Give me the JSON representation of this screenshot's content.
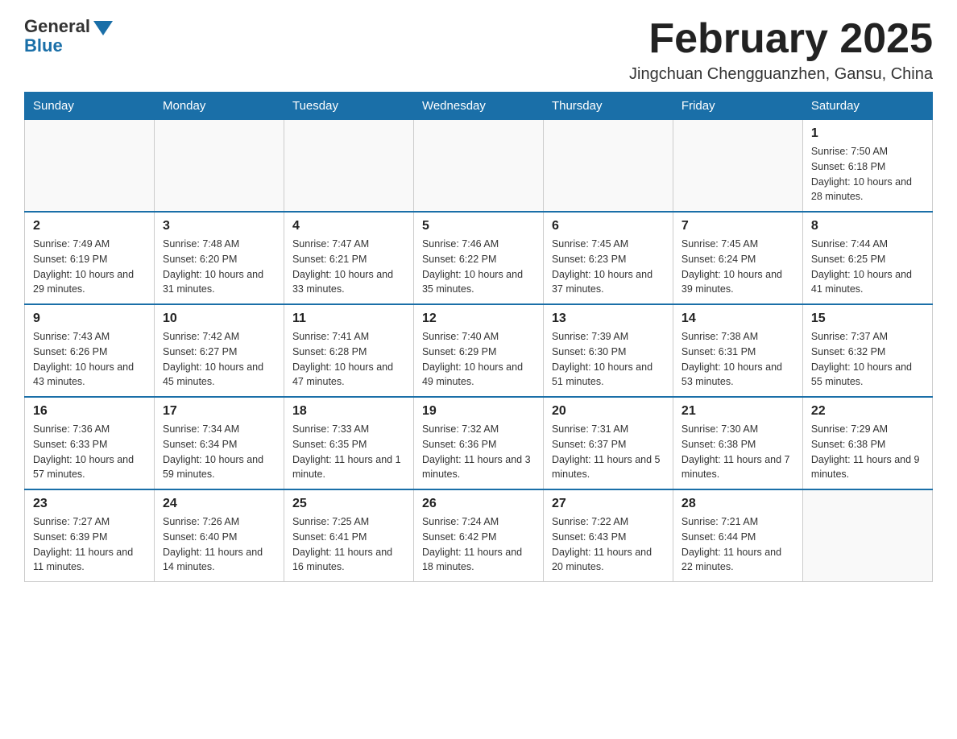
{
  "header": {
    "logo_general": "General",
    "logo_blue": "Blue",
    "month_title": "February 2025",
    "location": "Jingchuan Chengguanzhen, Gansu, China"
  },
  "days_of_week": [
    "Sunday",
    "Monday",
    "Tuesday",
    "Wednesday",
    "Thursday",
    "Friday",
    "Saturday"
  ],
  "weeks": [
    [
      {
        "day": "",
        "info": ""
      },
      {
        "day": "",
        "info": ""
      },
      {
        "day": "",
        "info": ""
      },
      {
        "day": "",
        "info": ""
      },
      {
        "day": "",
        "info": ""
      },
      {
        "day": "",
        "info": ""
      },
      {
        "day": "1",
        "info": "Sunrise: 7:50 AM\nSunset: 6:18 PM\nDaylight: 10 hours and 28 minutes."
      }
    ],
    [
      {
        "day": "2",
        "info": "Sunrise: 7:49 AM\nSunset: 6:19 PM\nDaylight: 10 hours and 29 minutes."
      },
      {
        "day": "3",
        "info": "Sunrise: 7:48 AM\nSunset: 6:20 PM\nDaylight: 10 hours and 31 minutes."
      },
      {
        "day": "4",
        "info": "Sunrise: 7:47 AM\nSunset: 6:21 PM\nDaylight: 10 hours and 33 minutes."
      },
      {
        "day": "5",
        "info": "Sunrise: 7:46 AM\nSunset: 6:22 PM\nDaylight: 10 hours and 35 minutes."
      },
      {
        "day": "6",
        "info": "Sunrise: 7:45 AM\nSunset: 6:23 PM\nDaylight: 10 hours and 37 minutes."
      },
      {
        "day": "7",
        "info": "Sunrise: 7:45 AM\nSunset: 6:24 PM\nDaylight: 10 hours and 39 minutes."
      },
      {
        "day": "8",
        "info": "Sunrise: 7:44 AM\nSunset: 6:25 PM\nDaylight: 10 hours and 41 minutes."
      }
    ],
    [
      {
        "day": "9",
        "info": "Sunrise: 7:43 AM\nSunset: 6:26 PM\nDaylight: 10 hours and 43 minutes."
      },
      {
        "day": "10",
        "info": "Sunrise: 7:42 AM\nSunset: 6:27 PM\nDaylight: 10 hours and 45 minutes."
      },
      {
        "day": "11",
        "info": "Sunrise: 7:41 AM\nSunset: 6:28 PM\nDaylight: 10 hours and 47 minutes."
      },
      {
        "day": "12",
        "info": "Sunrise: 7:40 AM\nSunset: 6:29 PM\nDaylight: 10 hours and 49 minutes."
      },
      {
        "day": "13",
        "info": "Sunrise: 7:39 AM\nSunset: 6:30 PM\nDaylight: 10 hours and 51 minutes."
      },
      {
        "day": "14",
        "info": "Sunrise: 7:38 AM\nSunset: 6:31 PM\nDaylight: 10 hours and 53 minutes."
      },
      {
        "day": "15",
        "info": "Sunrise: 7:37 AM\nSunset: 6:32 PM\nDaylight: 10 hours and 55 minutes."
      }
    ],
    [
      {
        "day": "16",
        "info": "Sunrise: 7:36 AM\nSunset: 6:33 PM\nDaylight: 10 hours and 57 minutes."
      },
      {
        "day": "17",
        "info": "Sunrise: 7:34 AM\nSunset: 6:34 PM\nDaylight: 10 hours and 59 minutes."
      },
      {
        "day": "18",
        "info": "Sunrise: 7:33 AM\nSunset: 6:35 PM\nDaylight: 11 hours and 1 minute."
      },
      {
        "day": "19",
        "info": "Sunrise: 7:32 AM\nSunset: 6:36 PM\nDaylight: 11 hours and 3 minutes."
      },
      {
        "day": "20",
        "info": "Sunrise: 7:31 AM\nSunset: 6:37 PM\nDaylight: 11 hours and 5 minutes."
      },
      {
        "day": "21",
        "info": "Sunrise: 7:30 AM\nSunset: 6:38 PM\nDaylight: 11 hours and 7 minutes."
      },
      {
        "day": "22",
        "info": "Sunrise: 7:29 AM\nSunset: 6:38 PM\nDaylight: 11 hours and 9 minutes."
      }
    ],
    [
      {
        "day": "23",
        "info": "Sunrise: 7:27 AM\nSunset: 6:39 PM\nDaylight: 11 hours and 11 minutes."
      },
      {
        "day": "24",
        "info": "Sunrise: 7:26 AM\nSunset: 6:40 PM\nDaylight: 11 hours and 14 minutes."
      },
      {
        "day": "25",
        "info": "Sunrise: 7:25 AM\nSunset: 6:41 PM\nDaylight: 11 hours and 16 minutes."
      },
      {
        "day": "26",
        "info": "Sunrise: 7:24 AM\nSunset: 6:42 PM\nDaylight: 11 hours and 18 minutes."
      },
      {
        "day": "27",
        "info": "Sunrise: 7:22 AM\nSunset: 6:43 PM\nDaylight: 11 hours and 20 minutes."
      },
      {
        "day": "28",
        "info": "Sunrise: 7:21 AM\nSunset: 6:44 PM\nDaylight: 11 hours and 22 minutes."
      },
      {
        "day": "",
        "info": ""
      }
    ]
  ]
}
